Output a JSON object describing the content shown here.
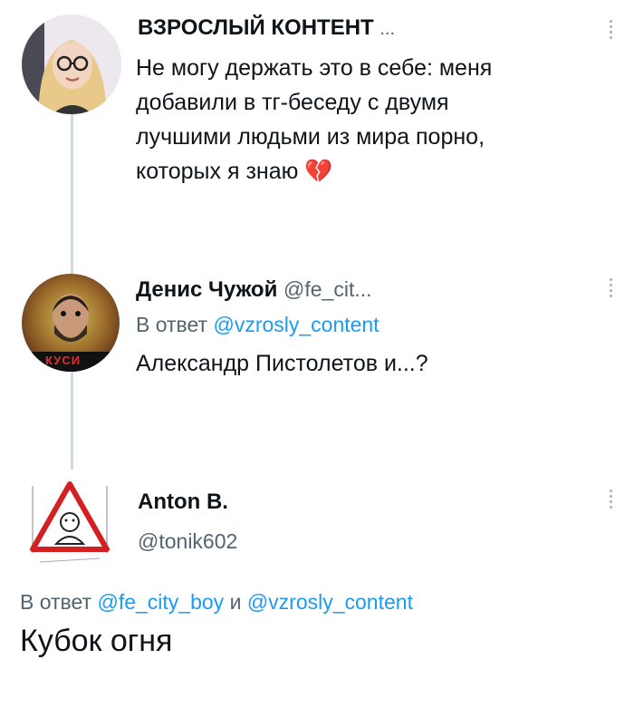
{
  "tweet1": {
    "author": "ВЗРОСЛЫЙ КОНТЕНТ",
    "author_suffix": "...",
    "lines": [
      "Не могу держать это в себе: меня",
      "добавили в тг-беседу с двумя",
      "лучшими людьми из мира порно,",
      "которых я знаю"
    ],
    "emoji": "💔"
  },
  "tweet2": {
    "author": "Денис Чужой",
    "handle": "@fe_cit...",
    "reply_prefix": "В ответ",
    "reply_handle": "@vzrosly_content",
    "text": "Александр Пистолетов и...?",
    "avatar_badge": "КУСИ"
  },
  "tweet3": {
    "author": "Anton B.",
    "handle": "@tonik602",
    "reply_prefix": "В ответ",
    "reply_handle1": "@fe_city_boy",
    "reply_and": "и",
    "reply_handle2": "@vzrosly_content",
    "text": "Кубок огня"
  },
  "colors": {
    "link": "#1d9bf0",
    "secondary": "#536471",
    "thread": "#cfd9de"
  }
}
